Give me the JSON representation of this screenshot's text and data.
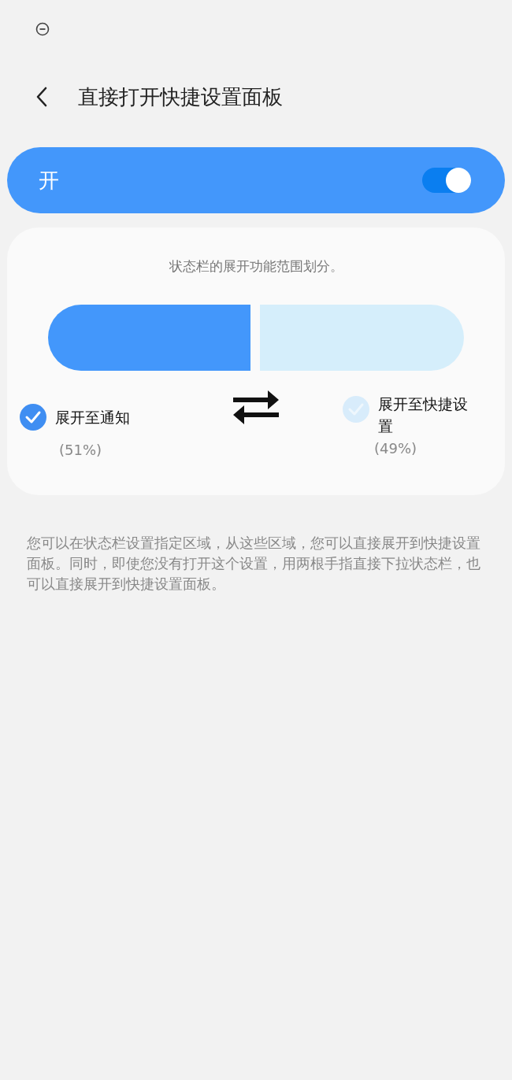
{
  "header": {
    "title": "直接打开快捷设置面板"
  },
  "master_switch": {
    "label": "开",
    "on": true
  },
  "split": {
    "caption": "状态栏的展开功能范围划分。",
    "level": 0.51,
    "options": [
      {
        "label": "展开至通知",
        "percent": "(51%)",
        "selected": true
      },
      {
        "label": "展开至快捷设置",
        "percent": "(49%)",
        "selected": false
      }
    ]
  },
  "description": "您可以在状态栏设置指定区域，从这些区域，您可以直接展开到快捷设置面板。同时，即使您没有打开这个设置，用两根手指直接下拉状态栏，也可以直接展开到快捷设置面板。"
}
